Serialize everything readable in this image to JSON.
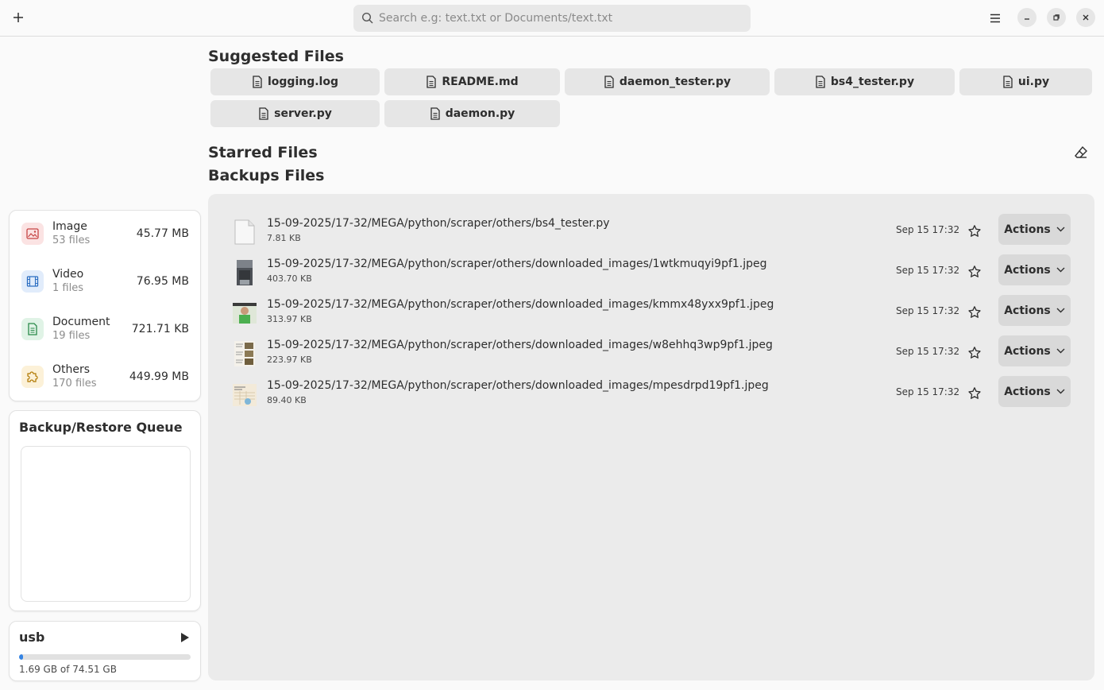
{
  "header": {
    "search_placeholder": "Search e.g: text.txt or Documents/text.txt"
  },
  "categories": [
    {
      "name": "Image",
      "count": "53 files",
      "size": "45.77 MB",
      "icon": "image-icon",
      "color": "#e66161"
    },
    {
      "name": "Video",
      "count": "1 files",
      "size": "76.95 MB",
      "icon": "film-icon",
      "color": "#3584e4"
    },
    {
      "name": "Document",
      "count": "19 files",
      "size": "721.71 KB",
      "icon": "document-icon",
      "color": "#33a35a"
    },
    {
      "name": "Others",
      "count": "170 files",
      "size": "449.99 MB",
      "icon": "puzzle-icon",
      "color": "#c88800"
    }
  ],
  "queue": {
    "title": "Backup/Restore Queue"
  },
  "usb": {
    "name": "usb",
    "usage": "1.69 GB of 74.51 GB",
    "used_fraction": 0.0227
  },
  "suggested": {
    "title": "Suggested Files",
    "files": [
      "logging.log",
      "README.md",
      "daemon_tester.py",
      "bs4_tester.py",
      "ui.py",
      "server.py",
      "daemon.py"
    ]
  },
  "starred": {
    "title": "Starred Files"
  },
  "backups": {
    "title": "Backups Files",
    "actions_label": "Actions",
    "files": [
      {
        "path": "15-09-2025/17-32/MEGA/python/scraper/others/bs4_tester.py",
        "size": "7.81 KB",
        "date": "Sep 15 17:32",
        "thumb": "text-file"
      },
      {
        "path": "15-09-2025/17-32/MEGA/python/scraper/others/downloaded_images/1wtkmuqyi9pf1.jpeg",
        "size": "403.70 KB",
        "date": "Sep 15 17:32",
        "thumb": "dark-photo"
      },
      {
        "path": "15-09-2025/17-32/MEGA/python/scraper/others/downloaded_images/kmmx48yxx9pf1.jpeg",
        "size": "313.97 KB",
        "date": "Sep 15 17:32",
        "thumb": "green-photo"
      },
      {
        "path": "15-09-2025/17-32/MEGA/python/scraper/others/downloaded_images/w8ehhq3wp9pf1.jpeg",
        "size": "223.97 KB",
        "date": "Sep 15 17:32",
        "thumb": "page-photo"
      },
      {
        "path": "15-09-2025/17-32/MEGA/python/scraper/others/downloaded_images/mpesdrpd19pf1.jpeg",
        "size": "89.40 KB",
        "date": "Sep 15 17:32",
        "thumb": "chart-photo"
      }
    ]
  }
}
